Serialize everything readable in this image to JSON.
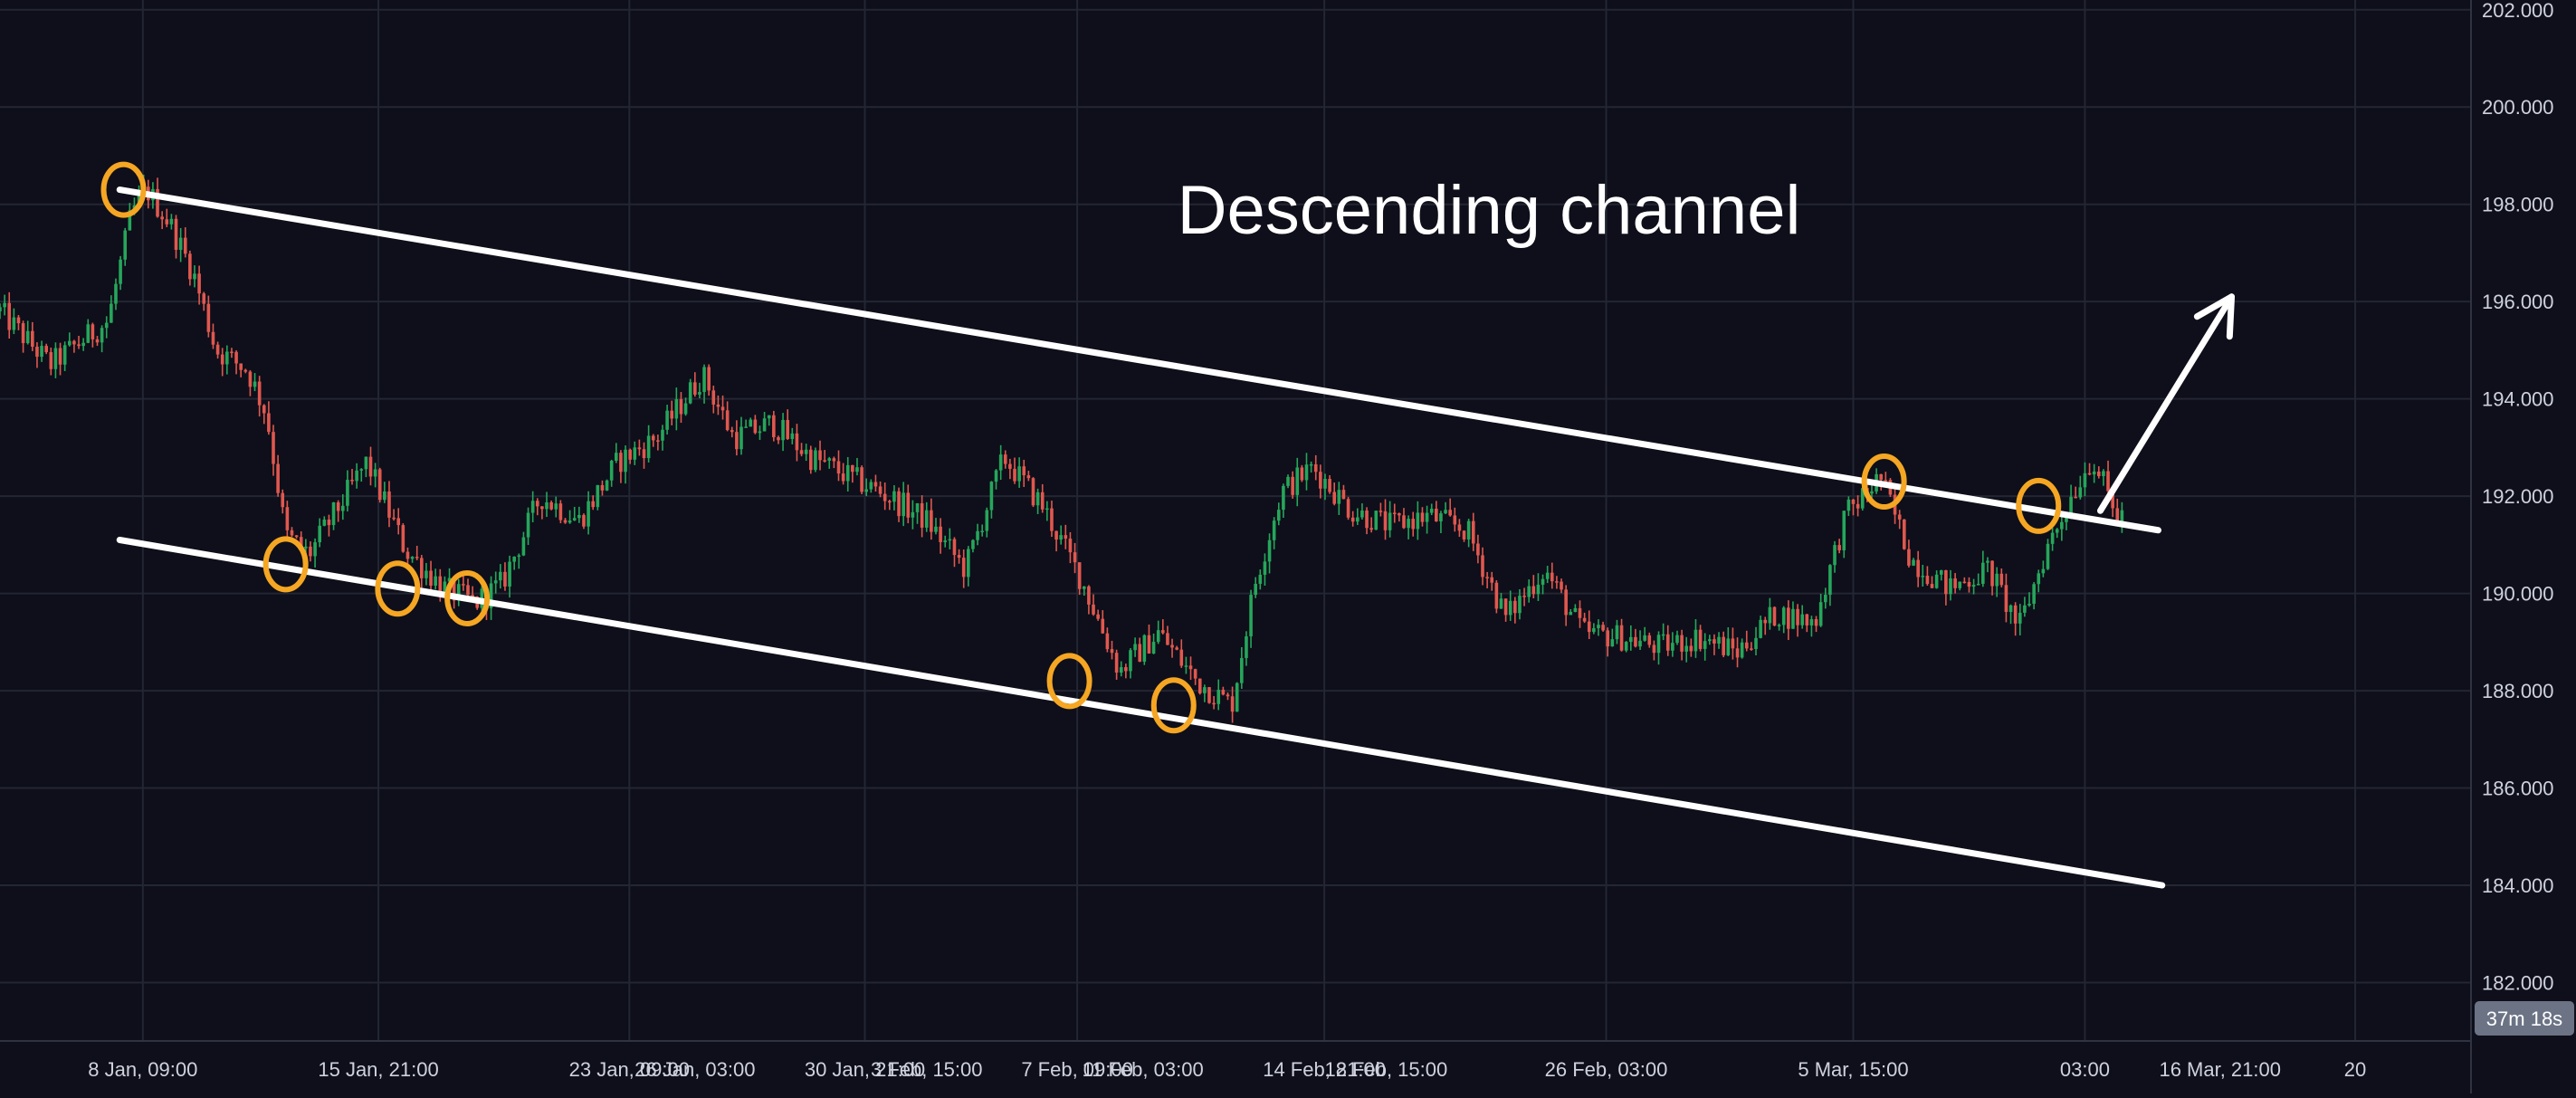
{
  "chart_data": {
    "type": "candlestick",
    "annotation": "Descending channel",
    "price_axis": {
      "labels": [
        "182.000",
        "184.000",
        "186.000",
        "188.000",
        "190.000",
        "192.000",
        "194.000",
        "196.000",
        "198.000",
        "200.000",
        "202.000"
      ],
      "range": [
        180.8,
        202.2
      ]
    },
    "time_axis": {
      "labels": [
        "8 Jan, 09:00",
        "15 Jan, 21:00",
        "23 Jan, 09:00",
        "26 Jan, 03:00",
        "30 Jan, 21:00",
        "3 Feb, 15:00",
        "7 Feb, 09:00",
        "11 Feb, 03:00",
        "14 Feb, 21:00",
        "18 Feb, 15:00",
        "26 Feb, 03:00",
        "5 Mar, 15:00",
        "03:00",
        "16 Mar, 21:00",
        "20"
      ],
      "range": [
        0,
        64
      ]
    },
    "countdown": "37m 18s",
    "colors": {
      "background": "#0e0f1a",
      "grid": "#232633",
      "up": "#26a65b",
      "down": "#e0584f",
      "line": "#ffffff",
      "marker": "#f5a623",
      "axis_text": "#cfd2dc",
      "badge": "#6b7385"
    },
    "price_keypoints": [
      [
        0,
        195.8
      ],
      [
        1.3,
        194.7
      ],
      [
        2.8,
        195.6
      ],
      [
        3.4,
        197.8
      ],
      [
        3.8,
        198.3
      ],
      [
        4.4,
        197.6
      ],
      [
        5,
        196.6
      ],
      [
        5.6,
        195
      ],
      [
        6.4,
        194.6
      ],
      [
        6.9,
        193.7
      ],
      [
        7.4,
        191.2
      ],
      [
        8,
        190.8
      ],
      [
        9.5,
        192.7
      ],
      [
        10.5,
        190.9
      ],
      [
        11.5,
        190.1
      ],
      [
        12.3,
        189.8
      ],
      [
        13,
        190.2
      ],
      [
        14,
        192
      ],
      [
        15,
        191.5
      ],
      [
        16,
        192.7
      ],
      [
        17,
        193.2
      ],
      [
        18.2,
        194.5
      ],
      [
        19,
        193.2
      ],
      [
        20,
        193.5
      ],
      [
        21,
        192.8
      ],
      [
        22,
        192.4
      ],
      [
        23,
        192
      ],
      [
        24,
        191.5
      ],
      [
        25,
        190.5
      ],
      [
        26,
        192.8
      ],
      [
        27,
        191.8
      ],
      [
        28,
        190.3
      ],
      [
        29,
        188.4
      ],
      [
        30,
        189.2
      ],
      [
        31,
        188.2
      ],
      [
        31.9,
        187.7
      ],
      [
        32.5,
        190.2
      ],
      [
        33.2,
        192.1
      ],
      [
        34,
        192.6
      ],
      [
        35,
        191.7
      ],
      [
        36,
        191.4
      ],
      [
        37,
        191.6
      ],
      [
        38,
        191.3
      ],
      [
        39,
        189.5
      ],
      [
        40,
        190.5
      ],
      [
        41,
        189.2
      ],
      [
        42,
        189.1
      ],
      [
        43,
        188.9
      ],
      [
        44,
        189.1
      ],
      [
        45,
        188.8
      ],
      [
        46,
        189.6
      ],
      [
        47,
        189.4
      ],
      [
        47.8,
        191.6
      ],
      [
        48.7,
        192.4
      ],
      [
        49.5,
        190.7
      ],
      [
        50.5,
        190.1
      ],
      [
        51.5,
        190.5
      ],
      [
        52.3,
        189.3
      ],
      [
        53,
        190.9
      ],
      [
        53.7,
        192.1
      ],
      [
        54.2,
        192.8
      ],
      [
        54.8,
        191.6
      ]
    ],
    "channel_lines": [
      {
        "name": "upper",
        "points": [
          [
            3.1,
            198.3
          ],
          [
            55.9,
            191.3
          ]
        ]
      },
      {
        "name": "lower",
        "points": [
          [
            3.1,
            191.1
          ],
          [
            56.0,
            184.0
          ]
        ]
      }
    ],
    "breakout_arrow": {
      "from": [
        54.4,
        191.7
      ],
      "to": [
        57.8,
        196.1
      ]
    },
    "touch_points": [
      {
        "name": "upper-touch-1",
        "at": [
          3.2,
          198.3
        ]
      },
      {
        "name": "lower-touch-1",
        "at": [
          7.4,
          190.6
        ]
      },
      {
        "name": "lower-touch-2",
        "at": [
          10.3,
          190.1
        ]
      },
      {
        "name": "lower-touch-3",
        "at": [
          12.1,
          189.9
        ]
      },
      {
        "name": "lower-touch-4",
        "at": [
          27.7,
          188.2
        ]
      },
      {
        "name": "lower-touch-5",
        "at": [
          30.4,
          187.7
        ]
      },
      {
        "name": "upper-touch-2",
        "at": [
          48.8,
          192.3
        ]
      },
      {
        "name": "upper-touch-3",
        "at": [
          52.8,
          191.8
        ]
      }
    ]
  }
}
